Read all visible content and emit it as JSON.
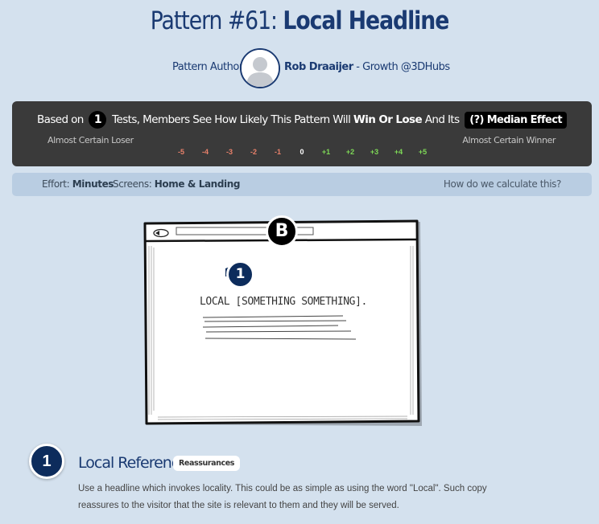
{
  "header": {
    "title_prefix": "Pattern #61: ",
    "title_main": "Local Headline",
    "author_label": "Pattern Author:",
    "author_name": "Rob Draaijer",
    "author_role": " - Growth @3DHubs"
  },
  "effect": {
    "text_before": "Based on",
    "tests_count": "1",
    "text_middle": "Tests, Members See How Likely This Pattern Will",
    "text_bold": "Win Or Lose",
    "text_after": "And Its",
    "median_label": "(?) Median Effect",
    "loser_label": "Almost Certain Loser",
    "winner_label": "Almost Certain Winner",
    "scale": [
      "-5",
      "-4",
      "-3",
      "-2",
      "-1",
      "0",
      "+1",
      "+2",
      "+3",
      "+4",
      "+5"
    ],
    "colors": {
      "negative": "#e8806a",
      "zero": "#ffffff",
      "positive": "#7ed957"
    }
  },
  "meta": {
    "effort_label": "Effort:",
    "effort_value": "Minutes",
    "screens_label": "Screens:",
    "screens_value": "Home & Landing",
    "calc_link": "How do we calculate this?"
  },
  "sketch": {
    "variant_badge": "B",
    "marker_number": "1",
    "headline_text": "LOCAL [SOMETHING SOMETHING]."
  },
  "item": {
    "number": "1",
    "title": "Local Reference",
    "tag": "Reassurances",
    "description": "Use a headline which invokes locality. This could be as simple as using the word \"Local\". Such copy reassures to the visitor that the site is relevant to them and they will be served."
  }
}
